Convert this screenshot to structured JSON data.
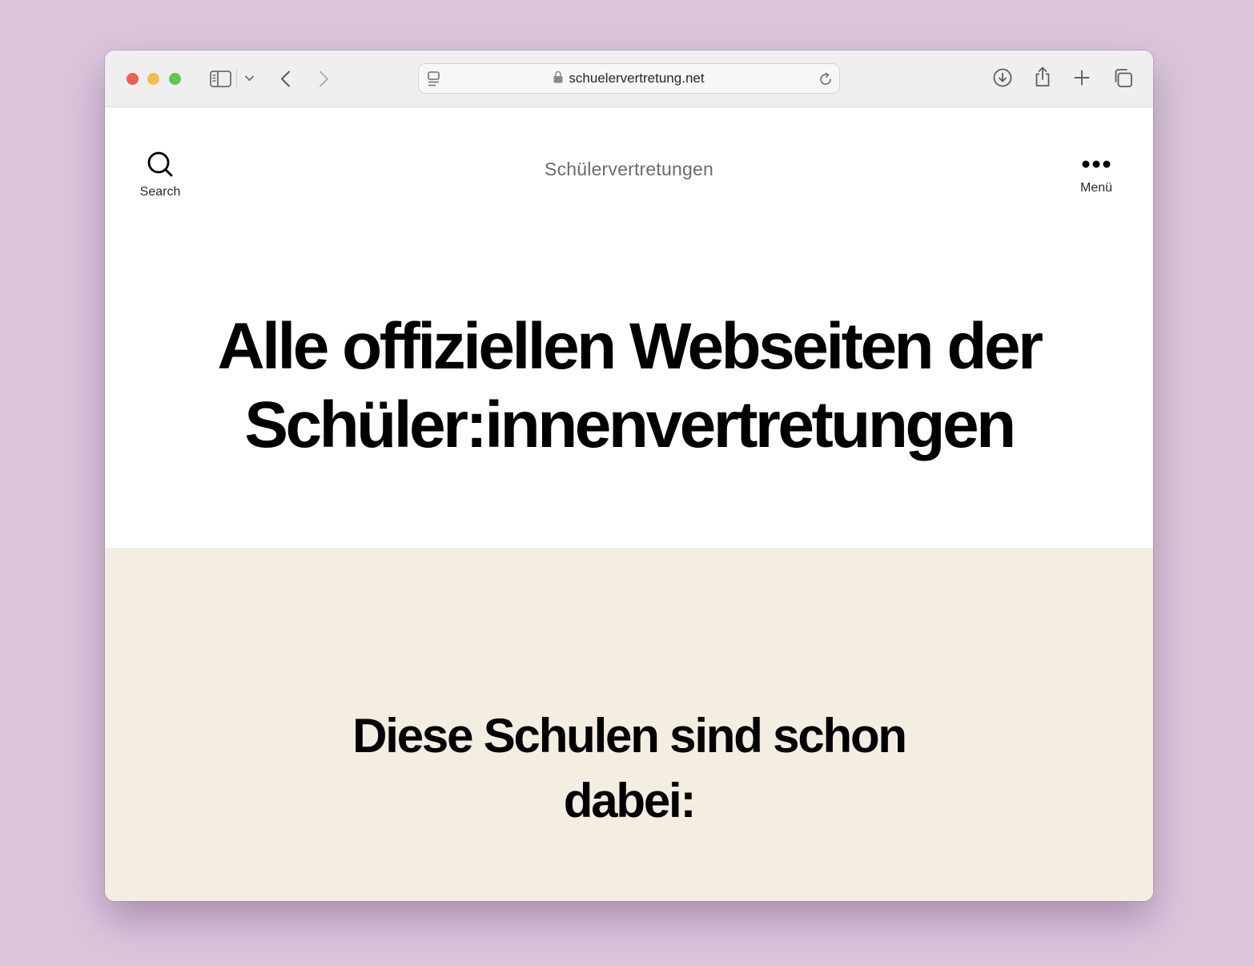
{
  "browser": {
    "url": "schuelervertretung.net",
    "icons": {
      "sidebar": "sidebar-icon",
      "sidebar_menu": "chevron-down-icon",
      "back": "chevron-left-icon",
      "forward": "chevron-right-icon",
      "page_menu": "page-menu-icon",
      "lock": "lock-icon",
      "reload": "reload-icon",
      "downloads": "download-icon",
      "share": "share-icon",
      "new_tab": "plus-icon",
      "tab_overview": "tabs-icon"
    }
  },
  "header": {
    "search_label": "Search",
    "site_title": "Schülervertretungen",
    "menu_label": "Menü"
  },
  "hero": {
    "title": "Alle offiziellen Webseiten der Schüler:innenvertretungen"
  },
  "section": {
    "title": "Diese Schulen sind schon dabei:"
  },
  "colors": {
    "desktop_background": "#dcc6de",
    "toolbar": "#efefef",
    "page_background": "#ffffff",
    "section_background": "#f4ede2",
    "site_title": "#6b6b6b",
    "heading": "#000000"
  }
}
